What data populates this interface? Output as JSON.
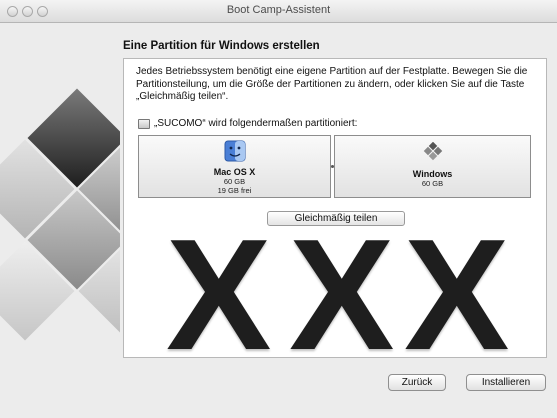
{
  "window": {
    "title": "Boot Camp-Assistent"
  },
  "header": {
    "title": "Eine Partition für Windows erstellen"
  },
  "description": "Jedes Betriebssystem benötigt eine eigene Partition auf der Festplatte. Bewegen Sie die Partitionsteilung, um die Größe der Partitionen zu ändern, oder klicken Sie auf die Taste „Gleichmäßig teilen“.",
  "disk_line": "„SUCOMO“ wird folgendermaßen partitioniert:",
  "partitions": [
    {
      "name": "Mac OS X",
      "size": "60 GB",
      "free": "19 GB frei",
      "icon": "finder-icon"
    },
    {
      "name": "Windows",
      "size": "60 GB",
      "icon": "windows-logo-icon"
    }
  ],
  "split_button": "Gleichmäßig teilen",
  "x_letters": [
    "X",
    "X",
    "X"
  ],
  "buttons": {
    "back": "Zurück",
    "install": "Installieren"
  },
  "colors": {
    "window_bg": "#ececec",
    "panel_bg": "#ffffff"
  }
}
